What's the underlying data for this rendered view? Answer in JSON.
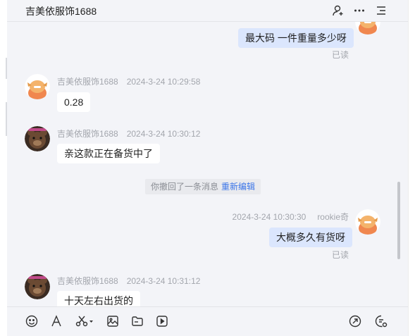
{
  "header": {
    "title": "吉美依服饰1688",
    "icons": [
      "add-contact-icon",
      "more-icon",
      "menu-icon"
    ]
  },
  "messages": {
    "m1": {
      "text": "最大码 一件重量多少呀",
      "status": "已读"
    },
    "m2": {
      "sender": "吉美依服饰1688",
      "time": "2024-3-24 10:29:58",
      "text": "0.28"
    },
    "m3": {
      "sender": "吉美依服饰1688",
      "time": "2024-3-24 10:30:12",
      "text": "亲这款正在备货中了"
    },
    "system": {
      "text": "你撤回了一条消息",
      "action": "重新编辑"
    },
    "m4": {
      "sender": "rookie奇",
      "time": "2024-3-24 10:30:30",
      "text": "大概多久有货呀",
      "status": "已读"
    },
    "m5": {
      "sender": "吉美依服饰1688",
      "time": "2024-3-24 10:31:12",
      "text": "十天左右出货的"
    }
  },
  "toolbar": {
    "left_icons": [
      "emoji-icon",
      "font-icon",
      "scissors-icon",
      "image-icon",
      "folder-icon",
      "video-icon"
    ],
    "right_icons": [
      "quick-reply-icon",
      "chat-history-icon"
    ]
  },
  "colors": {
    "chat_bg": "#f3f4f8",
    "incoming_bubble": "#ffffff",
    "outgoing_bubble": "#dbe6fd",
    "link": "#3d76e8",
    "meta_text": "#a3a6ad"
  }
}
